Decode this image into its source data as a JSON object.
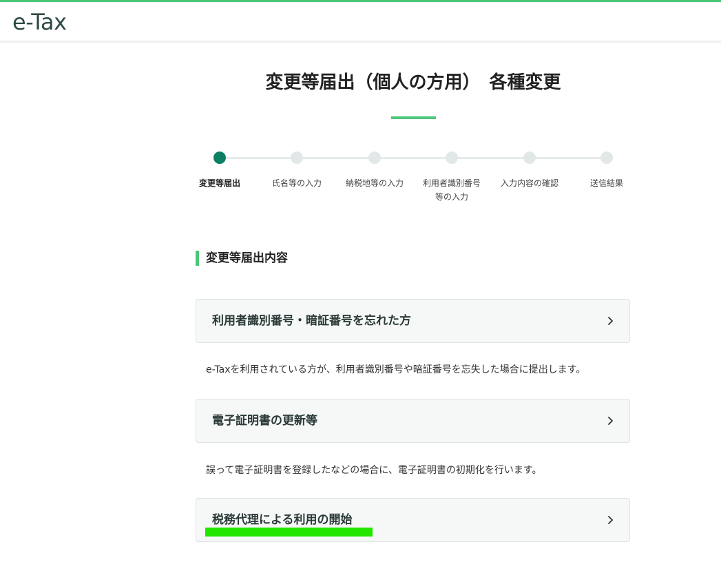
{
  "header": {
    "logo": "e-Tax",
    "accent_color": "#4cc77a"
  },
  "page": {
    "title": "変更等届出（個人の方用）　各種変更"
  },
  "stepper": {
    "active_index": 0,
    "active_color": "#0d7f65",
    "steps": [
      {
        "label": "変更等届出"
      },
      {
        "label": "氏名等の入力"
      },
      {
        "label": "納税地等の入力"
      },
      {
        "label": "利用者識別番号\n等の入力"
      },
      {
        "label": "入力内容の確認"
      },
      {
        "label": "送信結果"
      }
    ]
  },
  "section": {
    "heading": "変更等届出内容"
  },
  "options": [
    {
      "title": "利用者識別番号・暗証番号を忘れた方",
      "description": "e-Taxを利用されている方が、利用者識別番号や暗証番号を忘失した場合に提出します。",
      "icon": "chevron-right-icon"
    },
    {
      "title": "電子証明書の更新等",
      "description": "誤って電子証明書を登録したなどの場合に、電子証明書の初期化を行います。",
      "icon": "chevron-right-icon"
    },
    {
      "title": "税務代理による利用の開始",
      "icon": "chevron-right-icon",
      "highlight_color": "#22e600"
    }
  ]
}
